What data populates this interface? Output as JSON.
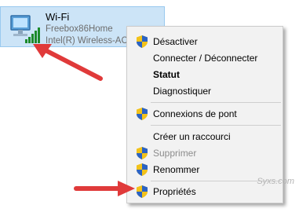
{
  "adapter": {
    "name": "Wi-Fi",
    "network": "Freebox86Home",
    "device": "Intel(R) Wireless-AC S"
  },
  "menu": {
    "items": [
      {
        "label": "Désactiver",
        "shield": true
      },
      {
        "label": "Connecter / Déconnecter"
      },
      {
        "label": "Statut",
        "bold": true
      },
      {
        "label": "Diagnostiquer"
      },
      {
        "label": "Connexions de pont",
        "shield": true
      },
      {
        "label": "Créer un raccourci"
      },
      {
        "label": "Supprimer",
        "shield": true,
        "disabled": true
      },
      {
        "label": "Renommer",
        "shield": true
      },
      {
        "label": "Propriétés",
        "shield": true
      }
    ]
  },
  "watermark": "Syxs.com",
  "colors": {
    "arrow": "#e03a3a",
    "tile_bg": "#cce4f7",
    "menu_bg": "#f2f2f2"
  }
}
